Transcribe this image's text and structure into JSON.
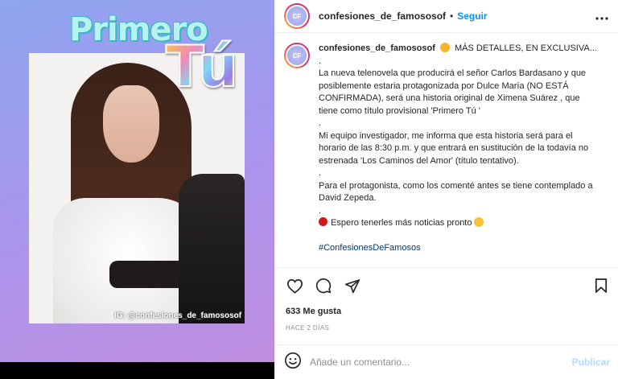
{
  "post": {
    "image_headline": "Primero",
    "image_title_word": "Tú",
    "image_watermark": "IG: @confesiones_de_famososof",
    "avatar_initials": "CF"
  },
  "header": {
    "username": "confesiones_de_famososof",
    "separator": "•",
    "follow_label": "Seguir",
    "more_label": "•••"
  },
  "caption": {
    "username": "confesiones_de_famososof",
    "first_line": "MÁS DETALLES, EN EXCLUSIVA...",
    "dot1": ".",
    "para1": "La nueva telenovela que producirá el señor Carlos Bardasano y que posiblemente estaria protagonizada por Dulce María (NO ESTÁ CONFIRMADA), será una historia original de Ximena Suárez , que tiene como título provisional 'Primero Tú '",
    "dot2": ".",
    "para2": "Mi equipo investigador, me informa que esta historia será para el horario de las 8:30 p.m. y que entrará en sustitución de la todavía no estrenada 'Los Caminos del Amor' (título tentativo).",
    "dot3": ".",
    "para3": "Para el protagonista, como los comenté antes se tiene contemplado a David Zepeda.",
    "dot4": ".",
    "para4": "Espero tenerles más noticias pronto",
    "hashtag": "#ConfesionesDeFamosos"
  },
  "actions": {
    "like_icon": "heart-icon",
    "comment_icon": "comment-icon",
    "share_icon": "share-icon",
    "save_icon": "bookmark-icon"
  },
  "likes": "633 Me gusta",
  "time_ago": "HACE 2 DÍAS",
  "comment": {
    "placeholder": "Añade un comentario...",
    "publish_label": "Publicar"
  },
  "colors": {
    "follow": "#0095f6",
    "publish_disabled": "#b3dbff",
    "hashtag": "#00376b"
  }
}
